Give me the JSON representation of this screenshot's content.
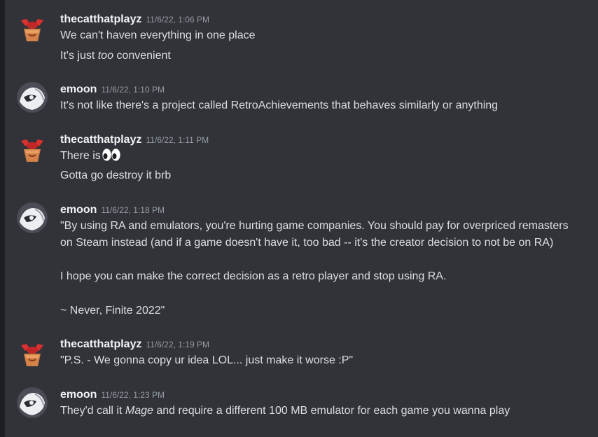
{
  "colors": {
    "background": "#313338",
    "rail": "#1e1f22",
    "username": "#f2f3f5",
    "timestamp": "#949ba4",
    "text": "#dbdee1"
  },
  "messages": [
    {
      "user": "thecatthatplayz",
      "avatar": "thecatthatplayz-avatar-icon",
      "timestamp": "11/6/22, 1:06 PM",
      "lines": [
        {
          "text": "We can't haven everything in one place"
        },
        {
          "pre": "It's just ",
          "em": "too",
          "post": " convenient"
        }
      ]
    },
    {
      "user": "emoon",
      "avatar": "emoon-avatar-icon",
      "timestamp": "11/6/22, 1:10 PM",
      "lines": [
        {
          "text": "It's not like there's a project called RetroAchievements that behaves similarly or anything"
        }
      ]
    },
    {
      "user": "thecatthatplayz",
      "avatar": "thecatthatplayz-avatar-icon",
      "timestamp": "11/6/22, 1:11 PM",
      "lines": [
        {
          "text": "There is",
          "emoji": "eyes-icon"
        },
        {
          "text": "Gotta go destroy it brb"
        }
      ]
    },
    {
      "user": "emoon",
      "avatar": "emoon-avatar-icon",
      "timestamp": "11/6/22, 1:18 PM",
      "lines": [
        {
          "text": "\"By using RA and emulators, you're hurting game companies. You should pay for overpriced remasters"
        },
        {
          "text": "on Steam instead (and if a game doesn't have it, too bad -- it's the creator decision to not be on RA)"
        },
        {
          "text": "I hope you can make the correct decision as a retro player and stop using RA."
        },
        {
          "text": "~ Never, Finite 2022\""
        }
      ]
    },
    {
      "user": "thecatthatplayz",
      "avatar": "thecatthatplayz-avatar-icon",
      "timestamp": "11/6/22, 1:19 PM",
      "lines": [
        {
          "text": "\"P.S. - We gonna copy ur idea LOL... just make it worse :P\""
        }
      ]
    },
    {
      "user": "emoon",
      "avatar": "emoon-avatar-icon",
      "timestamp": "11/6/22, 1:23 PM",
      "lines": [
        {
          "pre": "They'd call it ",
          "em": "Mage",
          "post": " and require a different 100 MB emulator for each game you wanna play"
        }
      ]
    }
  ]
}
